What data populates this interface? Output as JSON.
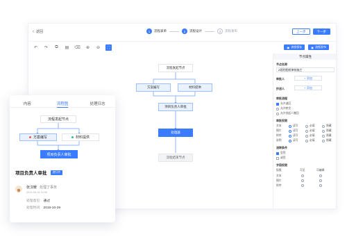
{
  "header": {
    "back_label": "返回",
    "steps": [
      {
        "num": "1",
        "label": "流程表单"
      },
      {
        "num": "2",
        "label": "流程设计"
      },
      {
        "num": "3",
        "label": "流程发布"
      }
    ],
    "prev_label": "上一步",
    "next_label": "下一步"
  },
  "toolbar": {
    "tools": [
      "undo-icon",
      "redo-icon",
      "copy-icon",
      "paste-icon",
      "delete-icon",
      "zoom-in-icon",
      "zoom-out-icon",
      "fit-icon"
    ],
    "btn_save": "流程保存",
    "btn_publish": "流程发布"
  },
  "canvas": {
    "nodes": {
      "start": "流程发起节点",
      "plan": "方案编写",
      "material": "材料提供",
      "review": "项目负责人审批",
      "active": "处理器",
      "end": "流程结束节点"
    }
  },
  "panel": {
    "title": "节点属性",
    "name_label": "节点名称",
    "name_value": "A规划图纸审核施工",
    "approver_label": "审批人",
    "add_label": "添加",
    "cc_label": "抄送人",
    "flow_label": "审批流程",
    "flow_options": [
      {
        "label": "允许退回",
        "checked": true
      },
      {
        "label": "允许转交",
        "checked": false
      },
      {
        "label": "允许发起人撤回",
        "checked": false
      }
    ],
    "perm_label": "审批权限",
    "perm_rows": [
      {
        "name": "文本",
        "opts": [
          "读写",
          "必填",
          "隐藏"
        ],
        "sel": 0
      },
      {
        "name": "图片",
        "opts": [
          "读写",
          "必填",
          "隐藏"
        ],
        "sel": 0
      },
      {
        "name": "附件",
        "opts": [
          "读写",
          "必填",
          "隐藏"
        ],
        "sel": 0
      },
      {
        "name": "说明",
        "opts": [
          "读写",
          "必填",
          "隐藏"
        ],
        "sel": 0
      }
    ],
    "cond_label": "流转条件",
    "cond_options": [
      {
        "label": "会签",
        "checked": true
      },
      {
        "label": "或签",
        "checked": false
      }
    ],
    "field_label": "字段权限",
    "field_headers": [
      "权限",
      "可见",
      "可编辑"
    ],
    "field_rows": [
      "文本",
      "图片",
      "附件"
    ]
  },
  "card": {
    "tabs": [
      "内容",
      "流程图",
      "处理日志"
    ],
    "active_tab": 1,
    "nodes": {
      "start": "流程发起节点",
      "plan": "方案编写",
      "material": "材料提供",
      "review": "项目负责人审批"
    },
    "title": "项目负责人审批",
    "badge": "进行中",
    "person": "张汉暖",
    "action": "处理了事务",
    "time": "2019-05-15 14:06",
    "opinion_label": "处理意见:",
    "opinion_value": "通过",
    "date_label": "处理时间:",
    "date_value": "2019-10-29"
  },
  "colors": {
    "accent": "#3a7bff",
    "node_bg": "#eaf2ff",
    "red_dot": "#f5554a",
    "green_dot": "#2fc27b"
  }
}
